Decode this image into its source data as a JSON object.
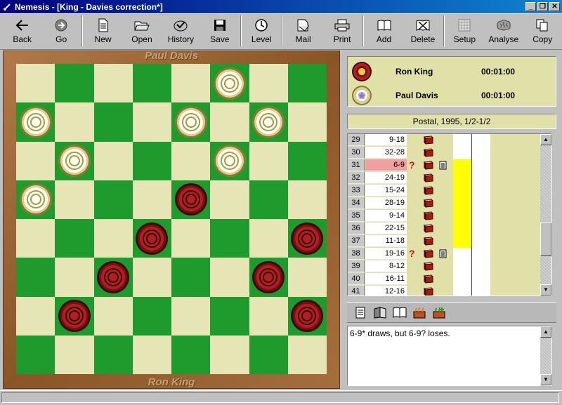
{
  "window": {
    "title": "Nemesis - [King - Davies correction*]"
  },
  "toolbar": [
    {
      "id": "back",
      "label": "Back",
      "icon": "back-arrow-icon"
    },
    {
      "id": "go",
      "label": "Go",
      "icon": "go-arrow-icon"
    },
    {
      "id": "new",
      "label": "New",
      "icon": "new-document-icon"
    },
    {
      "id": "open",
      "label": "Open",
      "icon": "open-folder-icon"
    },
    {
      "id": "history",
      "label": "History",
      "icon": "history-icon"
    },
    {
      "id": "save",
      "label": "Save",
      "icon": "floppy-disk-icon"
    },
    {
      "id": "level",
      "label": "Level",
      "icon": "clock-icon"
    },
    {
      "id": "mail",
      "label": "Mail",
      "icon": "mail-icon"
    },
    {
      "id": "print",
      "label": "Print",
      "icon": "printer-icon"
    },
    {
      "id": "add",
      "label": "Add",
      "icon": "add-book-icon"
    },
    {
      "id": "delete",
      "label": "Delete",
      "icon": "delete-book-icon"
    },
    {
      "id": "setup",
      "label": "Setup",
      "icon": "setup-board-icon"
    },
    {
      "id": "analyse",
      "label": "Analyse",
      "icon": "brain-icon"
    },
    {
      "id": "copy",
      "label": "Copy",
      "icon": "copy-icon"
    }
  ],
  "board": {
    "top_player": "Paul Davis",
    "bottom_player": "Ron King",
    "colors": {
      "light": "#e5e5b6",
      "dark": "#1f9a2c",
      "white_piece": "#fffff0",
      "red_piece": "#b02020"
    },
    "pieces": [
      {
        "row": 0,
        "col": 5,
        "color": "white"
      },
      {
        "row": 1,
        "col": 0,
        "color": "white"
      },
      {
        "row": 1,
        "col": 4,
        "color": "white"
      },
      {
        "row": 1,
        "col": 6,
        "color": "white"
      },
      {
        "row": 2,
        "col": 1,
        "color": "white"
      },
      {
        "row": 2,
        "col": 5,
        "color": "white"
      },
      {
        "row": 3,
        "col": 0,
        "color": "white"
      },
      {
        "row": 3,
        "col": 4,
        "color": "red"
      },
      {
        "row": 4,
        "col": 3,
        "color": "red"
      },
      {
        "row": 4,
        "col": 7,
        "color": "red"
      },
      {
        "row": 5,
        "col": 2,
        "color": "red"
      },
      {
        "row": 5,
        "col": 6,
        "color": "red"
      },
      {
        "row": 6,
        "col": 1,
        "color": "red"
      },
      {
        "row": 6,
        "col": 7,
        "color": "red"
      }
    ]
  },
  "players": [
    {
      "name": "Ron King",
      "time": "00:01:00",
      "medal": "red"
    },
    {
      "name": "Paul Davis",
      "time": "00:01:00",
      "medal": "white"
    }
  ],
  "event": "Postal, 1995, 1/2-1/2",
  "moves": [
    {
      "num": "29",
      "move": "9-18",
      "q": false,
      "note": false,
      "sel": false
    },
    {
      "num": "30",
      "move": "32-28",
      "q": false,
      "note": false,
      "sel": false
    },
    {
      "num": "31",
      "move": "6-9",
      "q": true,
      "note": true,
      "sel": true
    },
    {
      "num": "32",
      "move": "24-19",
      "q": false,
      "note": false,
      "sel": false
    },
    {
      "num": "33",
      "move": "15-24",
      "q": false,
      "note": false,
      "sel": false
    },
    {
      "num": "34",
      "move": "28-19",
      "q": false,
      "note": false,
      "sel": false
    },
    {
      "num": "35",
      "move": "9-14",
      "q": false,
      "note": false,
      "sel": false
    },
    {
      "num": "36",
      "move": "22-15",
      "q": false,
      "note": false,
      "sel": false
    },
    {
      "num": "37",
      "move": "11-18",
      "q": false,
      "note": false,
      "sel": false
    },
    {
      "num": "38",
      "move": "19-16",
      "q": true,
      "note": true,
      "sel": false
    },
    {
      "num": "39",
      "move": "8-12",
      "q": false,
      "note": false,
      "sel": false
    },
    {
      "num": "40",
      "move": "16-11",
      "q": false,
      "note": false,
      "sel": false
    },
    {
      "num": "41",
      "move": "12-16",
      "q": false,
      "note": false,
      "sel": false
    }
  ],
  "comment": "6-9* draws, but 6-9? loses."
}
